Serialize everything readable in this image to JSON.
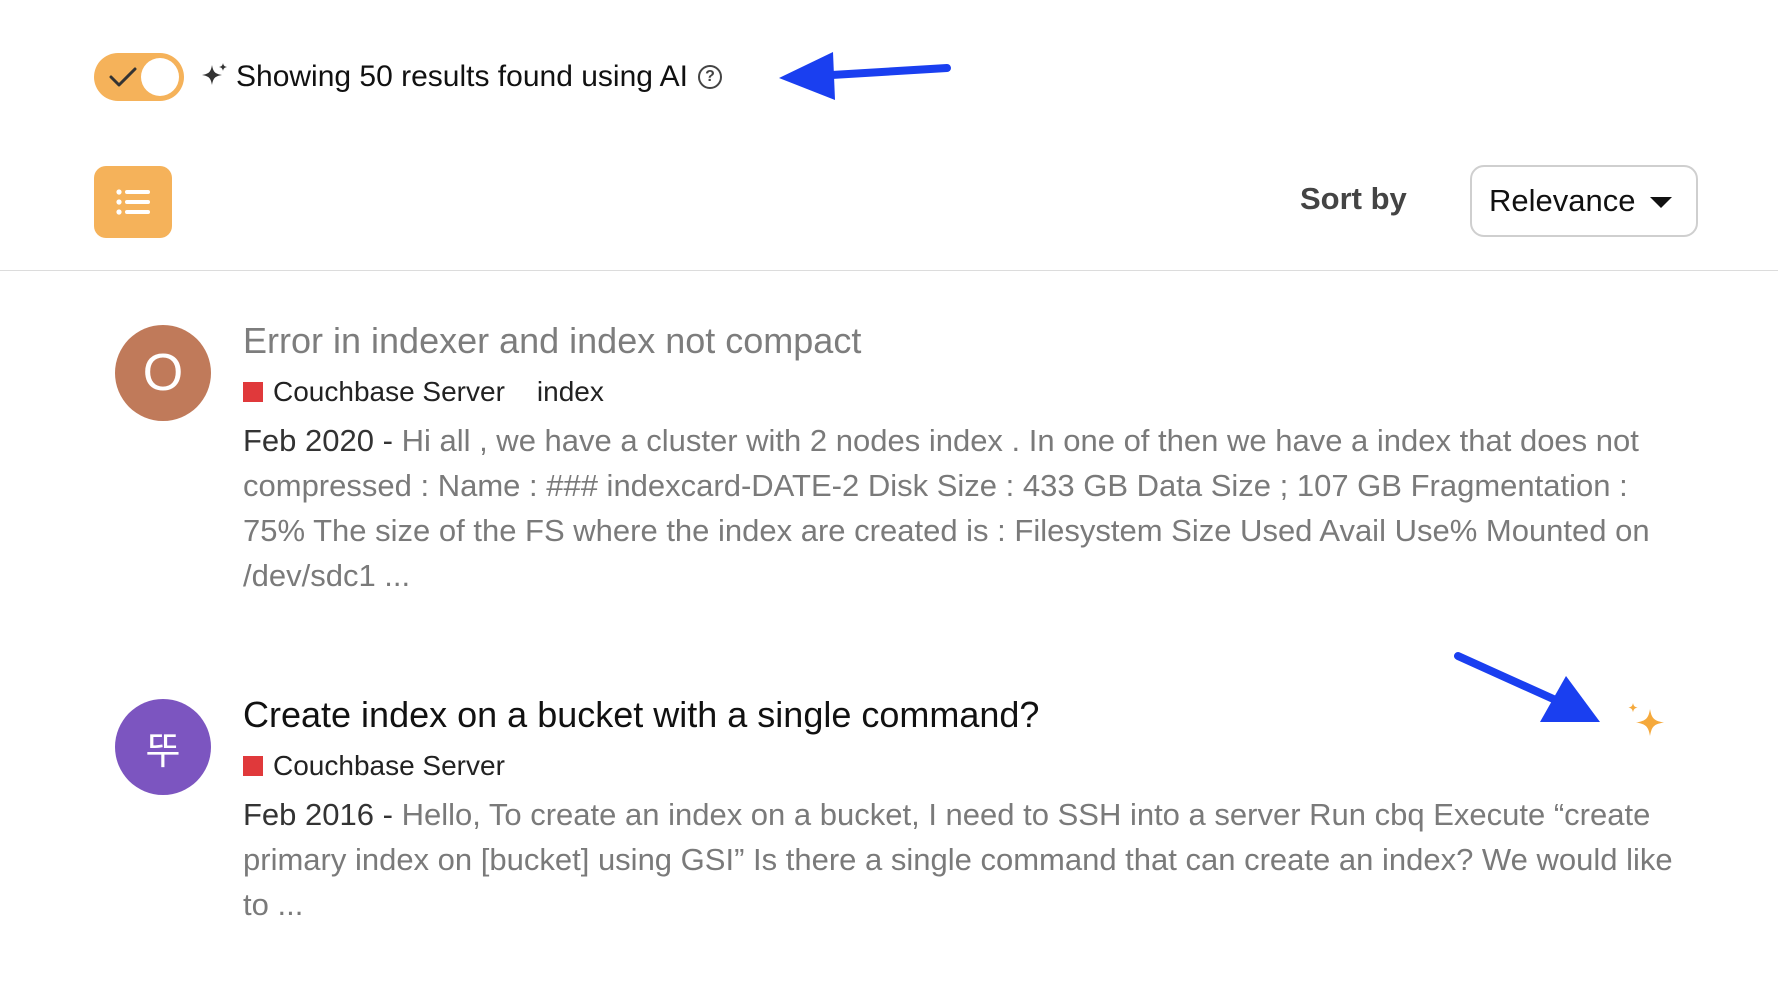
{
  "ai_toggle": {
    "enabled": true,
    "label": "Showing 50 results found using AI",
    "help_glyph": "?",
    "accent_color": "#f5b25a"
  },
  "toolbar": {
    "sort_label": "Sort by",
    "sort_value": "Relevance"
  },
  "annotation_color": "#1a3ff0",
  "results": [
    {
      "avatar_letter": "O",
      "avatar_color": "#c07a5a",
      "title": "Error in indexer and index not compact",
      "title_style": "visited",
      "category": "Couchbase Server",
      "category_color": "#e0393b",
      "tag": "index",
      "date": "Feb 2020",
      "excerpt": "Hi all , we have a cluster with 2 nodes index . In one of then we have a index that does not compressed : Name : ### indexcard-DATE-2 Disk Size : 433 GB Data Size ; 107 GB Fragmentation : 75% The size of the FS where the index are created is : Filesystem Size Used Avail Use% Mounted on /dev/sdc1 ...",
      "ai_found": false
    },
    {
      "avatar_letter": "뚜",
      "avatar_color": "#7c55c0",
      "title": "Create index on a bucket with a single command?",
      "title_style": "unvisited",
      "category": "Couchbase Server",
      "category_color": "#e0393b",
      "date": "Feb 2016",
      "excerpt": "Hello, To create an index on a bucket, I need to SSH into a server Run cbq Execute “create primary index on [bucket] using GSI” Is there a single command that can create an index? We would like to ...",
      "ai_found": true
    }
  ]
}
